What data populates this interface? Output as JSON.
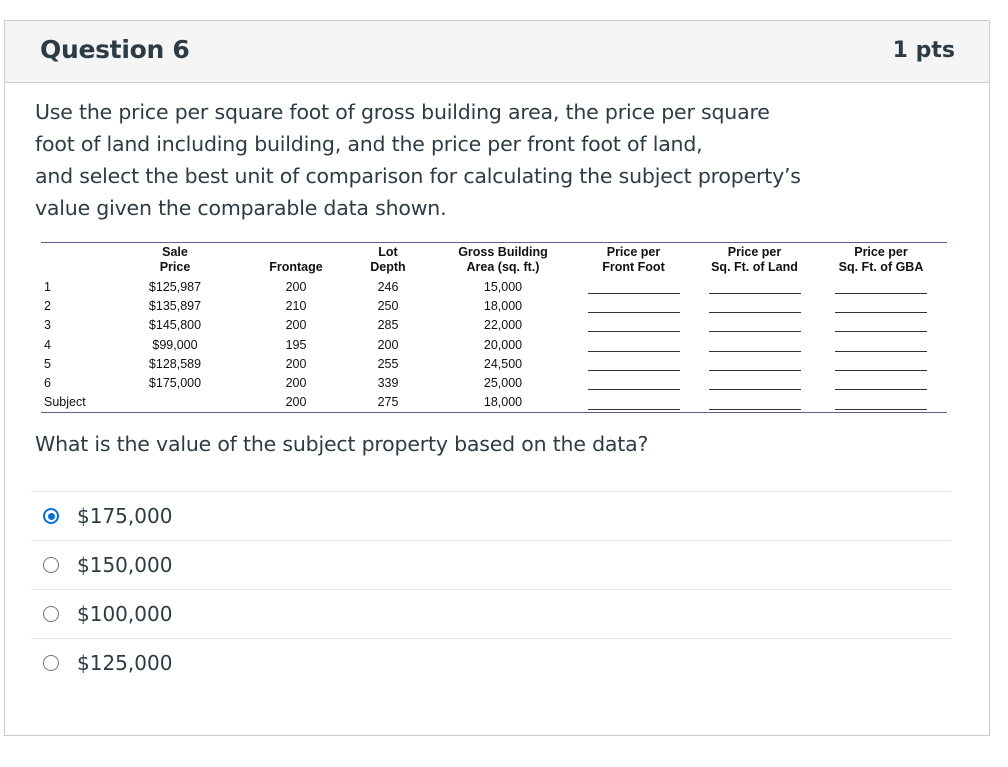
{
  "header": {
    "title": "Question 6",
    "points": "1 pts"
  },
  "prompt": {
    "line1": "Use the price per square foot of gross building area, the price per square",
    "line2": "foot of land including building, and the price per front foot of land,",
    "line3": "and select the best unit of comparison for calculating the subject property’s",
    "line4": "value given the comparable data shown."
  },
  "table": {
    "headers": {
      "sale_price_1": "Sale",
      "sale_price_2": "Price",
      "frontage": "Frontage",
      "lot_depth_1": "Lot",
      "lot_depth_2": "Depth",
      "gba_1": "Gross Building",
      "gba_2": "Area (sq. ft.)",
      "ppff_1": "Price per",
      "ppff_2": "Front Foot",
      "ppsf_land_1": "Price per",
      "ppsf_land_2": "Sq. Ft. of Land",
      "ppsf_gba_1": "Price per",
      "ppsf_gba_2": "Sq. Ft. of GBA"
    },
    "rows": [
      {
        "label": "1",
        "price": "$125,987",
        "frontage": "200",
        "depth": "246",
        "gba": "15,000"
      },
      {
        "label": "2",
        "price": "$135,897",
        "frontage": "210",
        "depth": "250",
        "gba": "18,000"
      },
      {
        "label": "3",
        "price": "$145,800",
        "frontage": "200",
        "depth": "285",
        "gba": "22,000"
      },
      {
        "label": "4",
        "price": "$99,000",
        "frontage": "195",
        "depth": "200",
        "gba": "20,000"
      },
      {
        "label": "5",
        "price": "$128,589",
        "frontage": "200",
        "depth": "255",
        "gba": "24,500"
      },
      {
        "label": "6",
        "price": "$175,000",
        "frontage": "200",
        "depth": "339",
        "gba": "25,000"
      },
      {
        "label": "Subject",
        "price": "",
        "frontage": "200",
        "depth": "275",
        "gba": "18,000"
      }
    ]
  },
  "question2": "What is the value of the subject property based on the data?",
  "answers": [
    {
      "label": "$175,000",
      "selected": true
    },
    {
      "label": "$150,000",
      "selected": false
    },
    {
      "label": "$100,000",
      "selected": false
    },
    {
      "label": "$125,000",
      "selected": false
    }
  ],
  "colors": {
    "radio_selected": "#0770d8",
    "header_bg": "#f5f5f5",
    "table_rule": "#6b5a8e"
  }
}
